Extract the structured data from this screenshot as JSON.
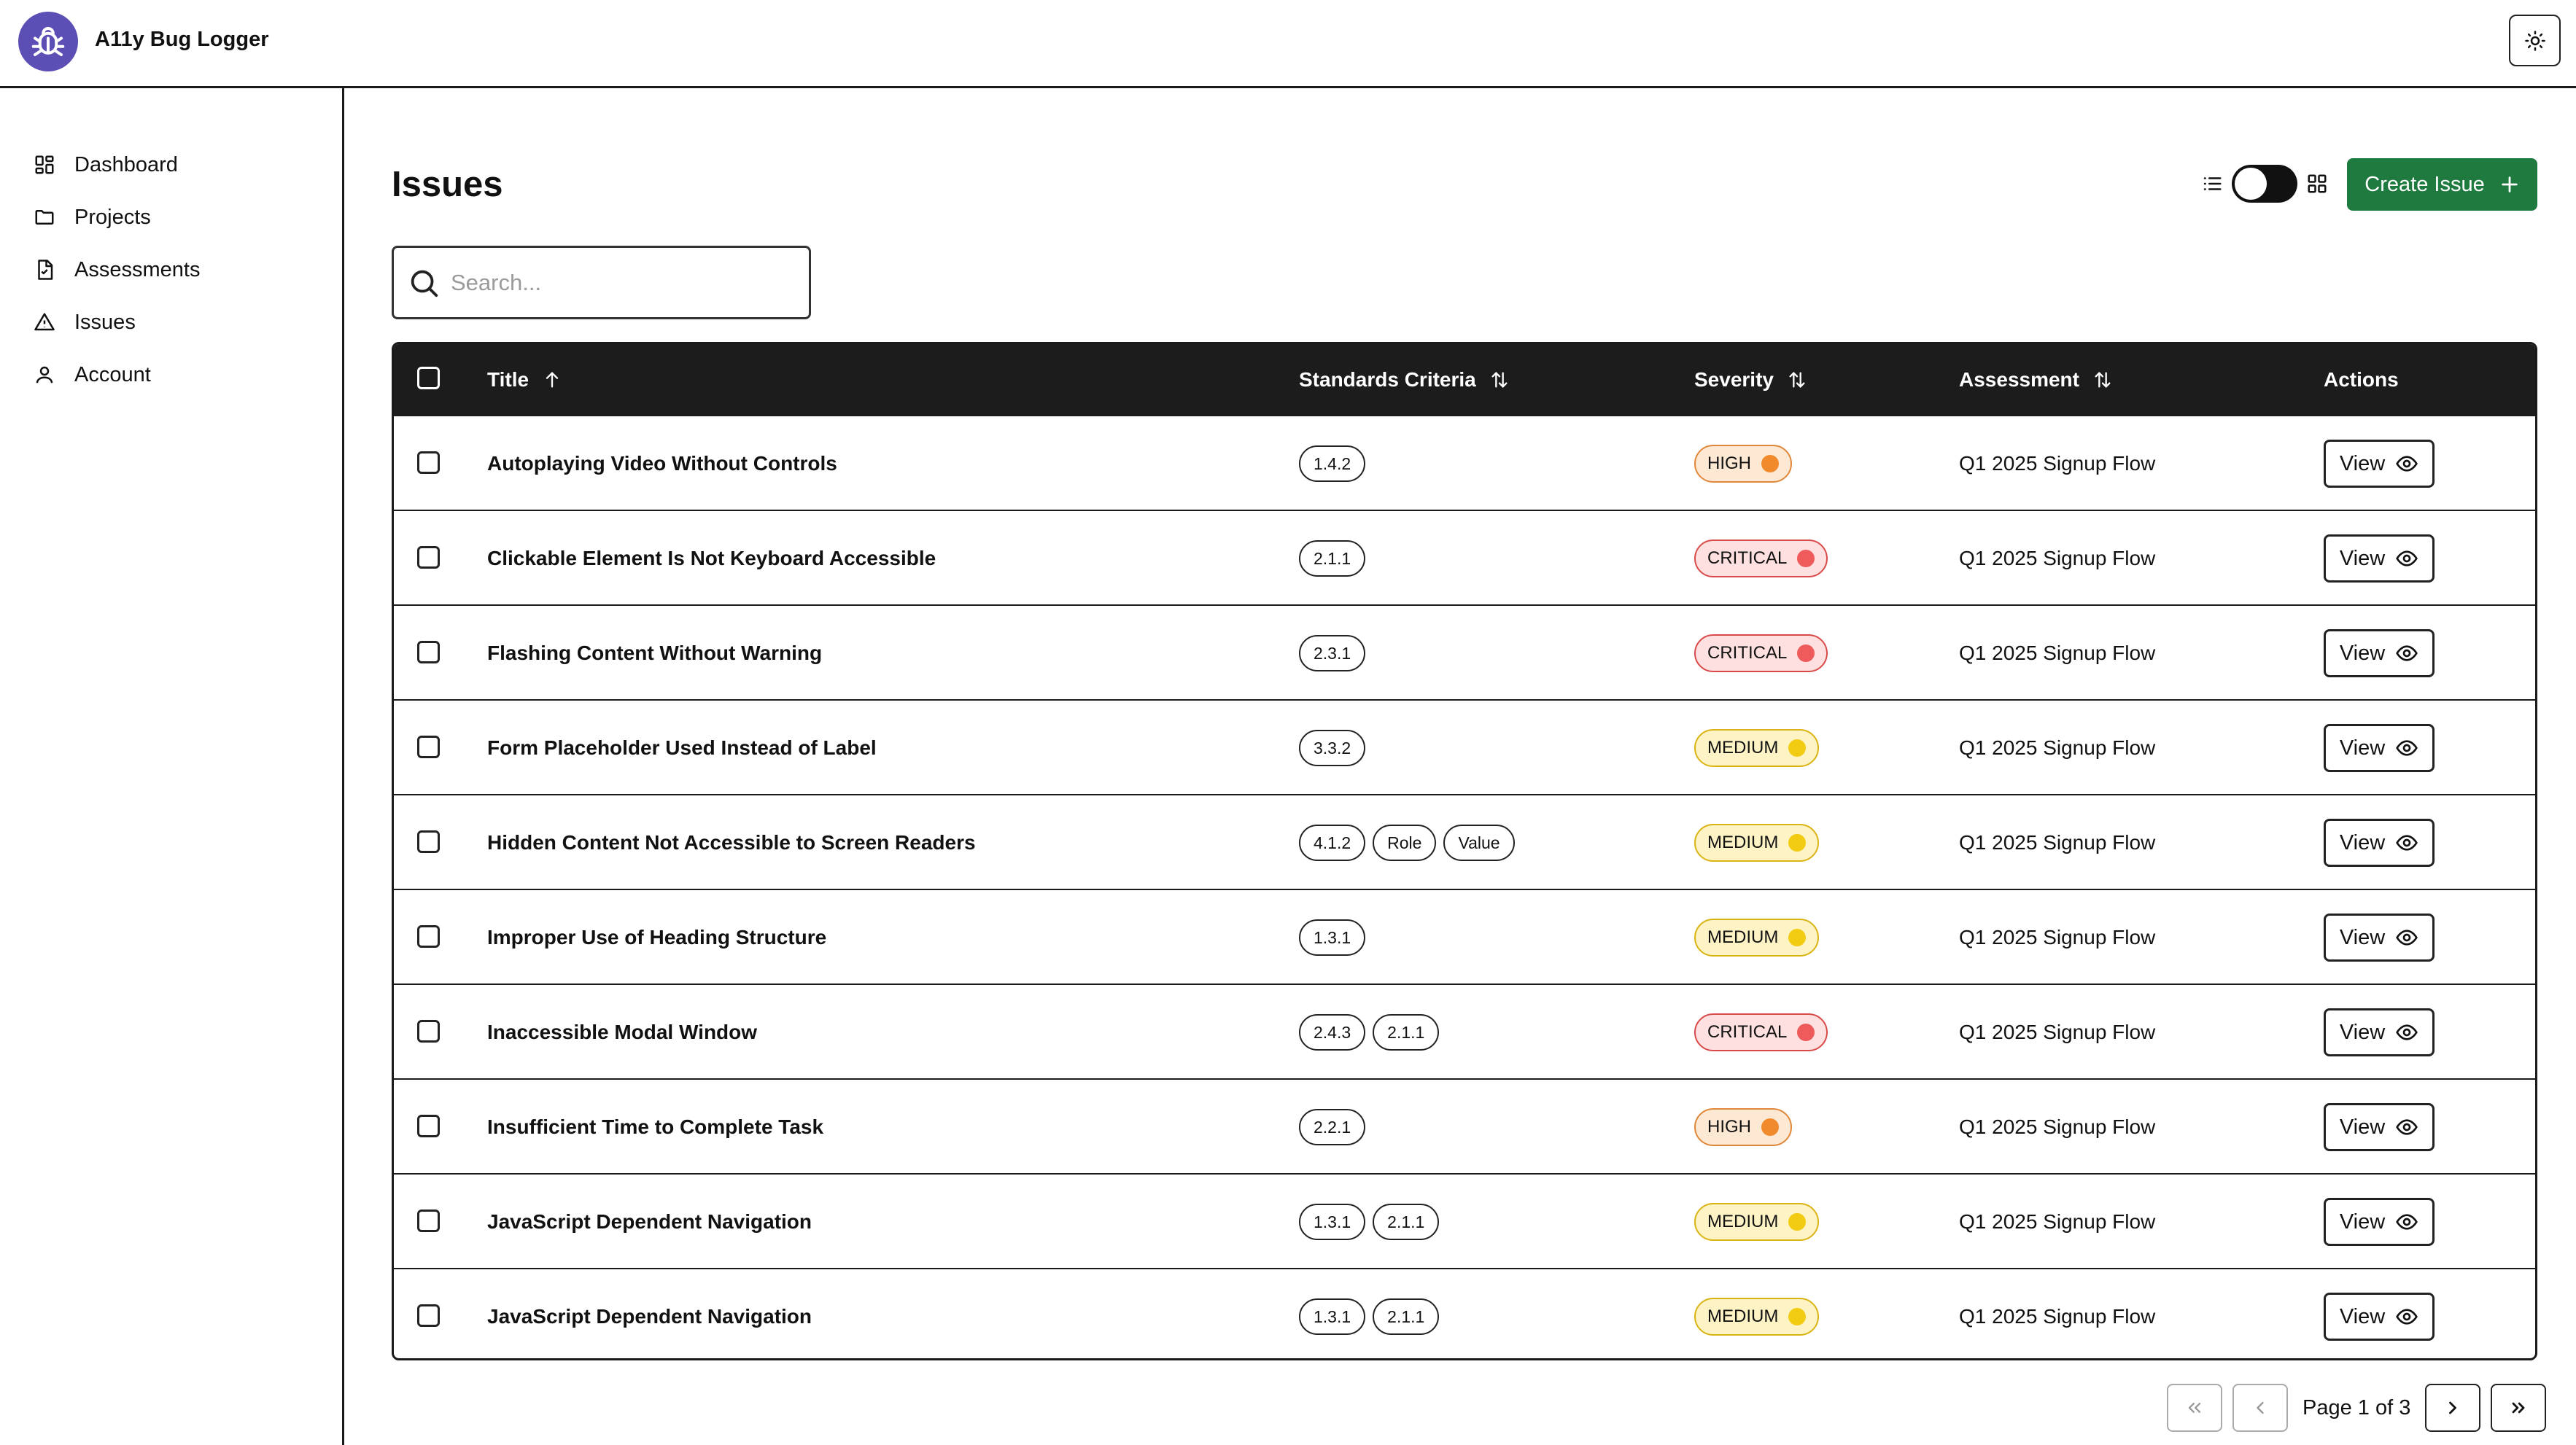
{
  "app": {
    "title": "A11y Bug Logger"
  },
  "header": {
    "theme_toggle_icon": "sun-icon"
  },
  "sidebar": {
    "items": [
      {
        "label": "Dashboard",
        "icon": "dashboard-icon"
      },
      {
        "label": "Projects",
        "icon": "folder-icon"
      },
      {
        "label": "Assessments",
        "icon": "document-check-icon"
      },
      {
        "label": "Issues",
        "icon": "warning-triangle-icon"
      },
      {
        "label": "Account",
        "icon": "user-icon"
      }
    ]
  },
  "page": {
    "title": "Issues",
    "create_label": "Create Issue",
    "search_placeholder": "Search..."
  },
  "table": {
    "columns": {
      "title": "Title",
      "criteria": "Standards Criteria",
      "severity": "Severity",
      "assessment": "Assessment",
      "actions": "Actions"
    },
    "view_label": "View",
    "rows": [
      {
        "title": "Autoplaying Video Without Controls",
        "criteria": [
          "1.4.2"
        ],
        "severity": "HIGH",
        "assessment": "Q1 2025 Signup Flow"
      },
      {
        "title": "Clickable Element Is Not Keyboard Accessible",
        "criteria": [
          "2.1.1"
        ],
        "severity": "CRITICAL",
        "assessment": "Q1 2025 Signup Flow"
      },
      {
        "title": "Flashing Content Without Warning",
        "criteria": [
          "2.3.1"
        ],
        "severity": "CRITICAL",
        "assessment": "Q1 2025 Signup Flow"
      },
      {
        "title": "Form Placeholder Used Instead of Label",
        "criteria": [
          "3.3.2"
        ],
        "severity": "MEDIUM",
        "assessment": "Q1 2025 Signup Flow"
      },
      {
        "title": "Hidden Content Not Accessible to Screen Readers",
        "criteria": [
          "4.1.2",
          "Role",
          "Value"
        ],
        "severity": "MEDIUM",
        "assessment": "Q1 2025 Signup Flow"
      },
      {
        "title": "Improper Use of Heading Structure",
        "criteria": [
          "1.3.1"
        ],
        "severity": "MEDIUM",
        "assessment": "Q1 2025 Signup Flow"
      },
      {
        "title": "Inaccessible Modal Window",
        "criteria": [
          "2.4.3",
          "2.1.1"
        ],
        "severity": "CRITICAL",
        "assessment": "Q1 2025 Signup Flow"
      },
      {
        "title": "Insufficient Time to Complete Task",
        "criteria": [
          "2.2.1"
        ],
        "severity": "HIGH",
        "assessment": "Q1 2025 Signup Flow"
      },
      {
        "title": "JavaScript Dependent Navigation",
        "criteria": [
          "1.3.1",
          "2.1.1"
        ],
        "severity": "MEDIUM",
        "assessment": "Q1 2025 Signup Flow"
      },
      {
        "title": "JavaScript Dependent Navigation",
        "criteria": [
          "1.3.1",
          "2.1.1"
        ],
        "severity": "MEDIUM",
        "assessment": "Q1 2025 Signup Flow"
      }
    ]
  },
  "severity_colors": {
    "HIGH": {
      "bg": "#fde8d3",
      "border": "#e0883a",
      "dot": "#f08a2c"
    },
    "CRITICAL": {
      "bg": "#fde0df",
      "border": "#d94a4a",
      "dot": "#ef5b5b"
    },
    "MEDIUM": {
      "bg": "#fdf3c4",
      "border": "#d9b412",
      "dot": "#f2cc12"
    }
  },
  "pagination": {
    "label": "Page 1 of 3"
  },
  "colors": {
    "accent": "#1f7a3f",
    "brand": "#5b4fb5",
    "header_bg": "#1c1c1c"
  }
}
